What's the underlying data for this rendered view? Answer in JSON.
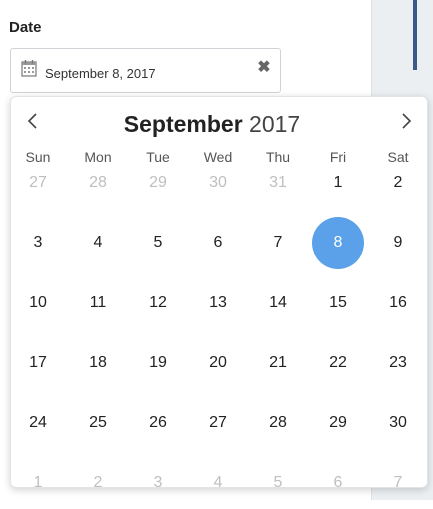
{
  "field": {
    "label": "Date",
    "value": "September 8, 2017",
    "clear_icon": "close-icon",
    "calendar_icon": "calendar-icon"
  },
  "calendar": {
    "month": "September",
    "year": "2017",
    "prev_icon": "chevron-left-icon",
    "next_icon": "chevron-right-icon",
    "weekdays": [
      "Sun",
      "Mon",
      "Tue",
      "Wed",
      "Thu",
      "Fri",
      "Sat"
    ],
    "selected_day": 8,
    "accent_color": "#5aa1ea",
    "weeks": [
      [
        {
          "d": "27",
          "m": true
        },
        {
          "d": "28",
          "m": true
        },
        {
          "d": "29",
          "m": true
        },
        {
          "d": "30",
          "m": true
        },
        {
          "d": "31",
          "m": true
        },
        {
          "d": "1"
        },
        {
          "d": "2"
        }
      ],
      [
        {
          "d": "3"
        },
        {
          "d": "4"
        },
        {
          "d": "5"
        },
        {
          "d": "6"
        },
        {
          "d": "7"
        },
        {
          "d": "8",
          "s": true
        },
        {
          "d": "9"
        }
      ],
      [
        {
          "d": "10"
        },
        {
          "d": "11"
        },
        {
          "d": "12"
        },
        {
          "d": "13"
        },
        {
          "d": "14"
        },
        {
          "d": "15"
        },
        {
          "d": "16"
        }
      ],
      [
        {
          "d": "17"
        },
        {
          "d": "18"
        },
        {
          "d": "19"
        },
        {
          "d": "20"
        },
        {
          "d": "21"
        },
        {
          "d": "22"
        },
        {
          "d": "23"
        }
      ],
      [
        {
          "d": "24"
        },
        {
          "d": "25"
        },
        {
          "d": "26"
        },
        {
          "d": "27"
        },
        {
          "d": "28"
        },
        {
          "d": "29"
        },
        {
          "d": "30"
        }
      ],
      [
        {
          "d": "1",
          "m": true
        },
        {
          "d": "2",
          "m": true
        },
        {
          "d": "3",
          "m": true
        },
        {
          "d": "4",
          "m": true
        },
        {
          "d": "5",
          "m": true
        },
        {
          "d": "6",
          "m": true
        },
        {
          "d": "7",
          "m": true
        }
      ]
    ]
  }
}
